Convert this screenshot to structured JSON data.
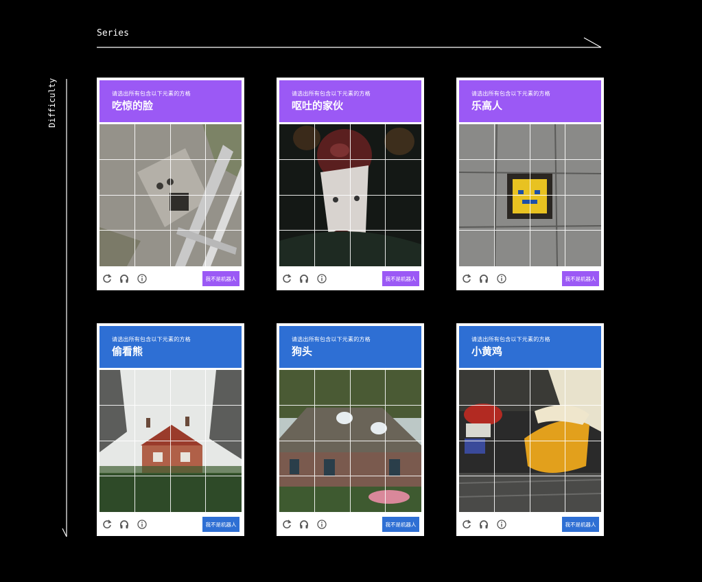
{
  "axes": {
    "series_label": "Series",
    "difficulty_label": "Difficulty"
  },
  "colors": {
    "purple": "#9b59f5",
    "blue": "#2e6fd4"
  },
  "cards": [
    {
      "instruction": "请选出所有包含以下元素的方格",
      "target": "吃惊的脸",
      "button_label": "我不是机器人",
      "theme": "purple",
      "icons": [
        "reload-icon",
        "headphones-icon",
        "info-icon"
      ]
    },
    {
      "instruction": "请选出所有包含以下元素的方格",
      "target": "呕吐的家伙",
      "button_label": "我不是机器人",
      "theme": "purple",
      "icons": [
        "reload-icon",
        "headphones-icon",
        "info-icon"
      ]
    },
    {
      "instruction": "请选出所有包含以下元素的方格",
      "target": "乐高人",
      "button_label": "我不是机器人",
      "theme": "purple",
      "icons": [
        "reload-icon",
        "headphones-icon",
        "info-icon"
      ]
    },
    {
      "instruction": "请选出所有包含以下元素的方格",
      "target": "偷看熊",
      "button_label": "我不是机器人",
      "theme": "blue",
      "icons": [
        "reload-icon",
        "headphones-icon",
        "info-icon"
      ]
    },
    {
      "instruction": "请选出所有包含以下元素的方格",
      "target": "狗头",
      "button_label": "我不是机器人",
      "theme": "blue",
      "icons": [
        "reload-icon",
        "headphones-icon",
        "info-icon"
      ]
    },
    {
      "instruction": "请选出所有包含以下元素的方格",
      "target": "小黄鸡",
      "button_label": "我不是机器人",
      "theme": "blue",
      "icons": [
        "reload-icon",
        "headphones-icon",
        "info-icon"
      ]
    }
  ]
}
